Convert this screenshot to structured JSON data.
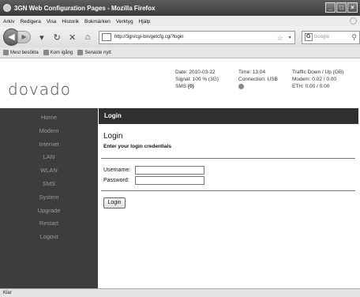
{
  "window": {
    "title": "3GN Web Configuration Pages - Mozilla Firefox"
  },
  "menu": [
    "Arkiv",
    "Redigera",
    "Visa",
    "Historik",
    "Bokmärken",
    "Verktyg",
    "Hjälp"
  ],
  "address": {
    "url": "http://3gn/cgi-bin/getcfg.cgi?login"
  },
  "search": {
    "placeholder": "Google"
  },
  "bookmarks": [
    "Mest besökta",
    "Kom igång",
    "Senaste nytt"
  ],
  "header": {
    "logo": "dovado",
    "date": "Date: 2010-03-22",
    "time": "Time: 13:04",
    "signal": "Signal: 100 % (3G)",
    "connection": "Connection: USB",
    "sms_label": "SMS",
    "sms_count": "(0)",
    "traffic_title": "Traffic Down / Up (GB)",
    "modem_traffic": "Modem: 0.02 / 0.00",
    "eth_traffic": "ETH: 0.00 / 0.00"
  },
  "nav": [
    "Home",
    "Modem",
    "Internet",
    "LAN",
    "WLAN",
    "SMS",
    "System",
    "Upgrade",
    "Restart",
    "Logout"
  ],
  "content": {
    "section_bar": "Login",
    "title": "Login",
    "subtitle": "Enter your login credentials",
    "username_label": "Username:",
    "password_label": "Password:",
    "username_value": "",
    "password_value": "",
    "login_button": "Login"
  },
  "status": {
    "text": "Klar"
  },
  "colors": {
    "nav_bg": "#3d3d3d",
    "nav_text": "#9a9a9a",
    "section_bar_bg": "#2f2f2f"
  }
}
